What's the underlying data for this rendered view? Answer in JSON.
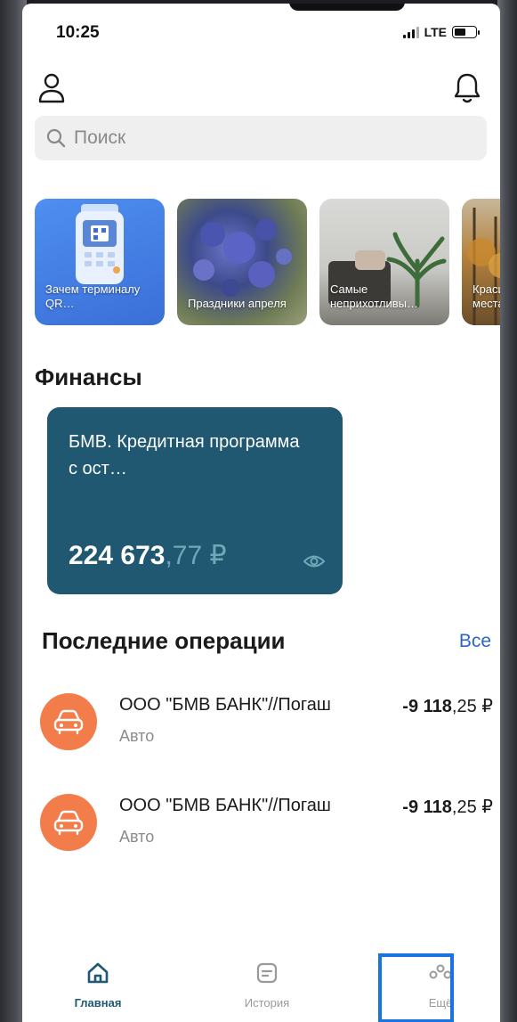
{
  "status_bar": {
    "time": "10:25",
    "network": "LTE"
  },
  "header": {
    "search_placeholder": "Поиск"
  },
  "stories": [
    {
      "title": "Зачем терминалу QR…"
    },
    {
      "title": "Праздники апреля"
    },
    {
      "title": "Самые неприхотливы…"
    },
    {
      "title": "Краси места"
    }
  ],
  "finance": {
    "section_title": "Финансы",
    "card": {
      "title": "БМВ. Кредитная программа с ост…",
      "amount_int": "224 673",
      "amount_frac": ",77 ₽"
    }
  },
  "operations": {
    "section_title": "Последние операции",
    "all_label": "Все",
    "items": [
      {
        "name": "ООО \"БМВ БАНК\"//Погаш",
        "category": "Авто",
        "amount_int": "-9 118",
        "amount_frac": ",25 ₽"
      },
      {
        "name": "ООО \"БМВ БАНК\"//Погаш",
        "category": "Авто",
        "amount_int": "-9 118",
        "amount_frac": ",25 ₽"
      }
    ]
  },
  "tabbar": {
    "items": [
      {
        "label": "Главная",
        "icon": "home-icon",
        "active": true
      },
      {
        "label": "История",
        "icon": "history-icon",
        "active": false
      },
      {
        "label": "Ещё",
        "icon": "more-icon",
        "active": false
      }
    ]
  },
  "colors": {
    "card_bg": "#1f5870",
    "accent_link": "#2a66c9",
    "op_icon_bg": "#f27d4b",
    "highlight": "#1a74e0"
  }
}
